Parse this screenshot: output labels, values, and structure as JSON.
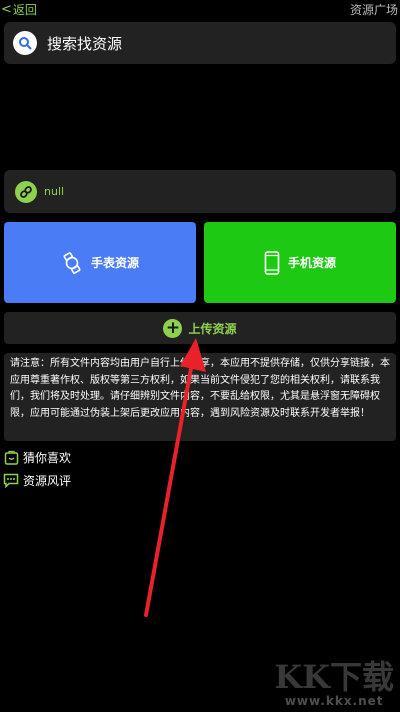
{
  "topbar": {
    "back_label": "返回",
    "title": "资源广场"
  },
  "search": {
    "label": "搜索找资源"
  },
  "status": {
    "label": "null"
  },
  "tiles": {
    "watch_label": "手表资源",
    "phone_label": "手机资源"
  },
  "upload": {
    "label": "上传资源"
  },
  "notice": {
    "text": "请注意：所有文件内容均由用户自行上传分享，本应用不提供存储，仅供分享链接，本应用尊重著作权、版权等第三方权利，如果当前文件侵犯了您的相关权利，请联系我们，我们将及时处理。请仔细辨别文件内容，不要乱给权限，尤其是悬浮窗无障碍权限，应用可能通过伪装上架后更改应用内容，遇到风险资源及时联系开发者举报！"
  },
  "links": {
    "guess_label": "猜你喜欢",
    "review_label": "资源风评"
  },
  "watermark": {
    "mark": "KK下载",
    "url": "www.kkx.net"
  },
  "colors": {
    "accent_green": "#8fd14f",
    "watch_tile": "#4a7cf5",
    "phone_tile": "#1ec913",
    "panel": "#222222",
    "arrow": "#e8212b"
  }
}
